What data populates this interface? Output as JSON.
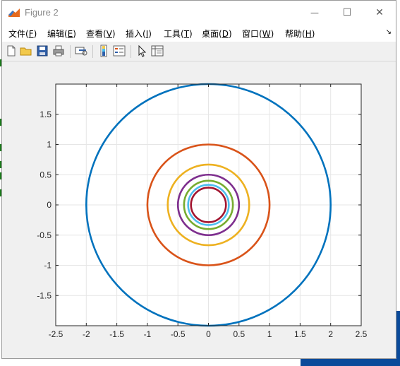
{
  "window": {
    "title": "Figure 2",
    "minimize_glyph": "—",
    "maximize_glyph": "☐",
    "close_glyph": "✕"
  },
  "menu": {
    "items": [
      {
        "label": "文件(",
        "key": "F",
        "suffix": ")"
      },
      {
        "label": "编辑(",
        "key": "E",
        "suffix": ")"
      },
      {
        "label": "查看(",
        "key": "V",
        "suffix": ")"
      },
      {
        "label": "插入(",
        "key": "I",
        "suffix": ")"
      },
      {
        "label": "工具(",
        "key": "T",
        "suffix": ")"
      },
      {
        "label": "桌面(",
        "key": "D",
        "suffix": ")"
      },
      {
        "label": "窗口(",
        "key": "W",
        "suffix": ")"
      },
      {
        "label": "帮助(",
        "key": "H",
        "suffix": ")"
      }
    ],
    "overflow_glyph": "↘"
  },
  "toolbar": {
    "icons": [
      "new-figure-icon",
      "open-file-icon",
      "save-icon",
      "print-icon",
      "link-plot-icon",
      "insert-colorbar-icon",
      "insert-legend-icon",
      "edit-plot-arrow-icon",
      "property-inspector-icon"
    ]
  },
  "chart_data": {
    "type": "line",
    "title": "",
    "xlabel": "",
    "ylabel": "",
    "xlim": [
      -2.5,
      2.5
    ],
    "ylim": [
      -2,
      2
    ],
    "xticks": [
      "-2.5",
      "-2",
      "-1.5",
      "-1",
      "-0.5",
      "0",
      "0.5",
      "1",
      "1.5",
      "2",
      "2.5"
    ],
    "yticks": [
      "1.5",
      "1",
      "0.5",
      "0",
      "-0.5",
      "-1",
      "-1.5"
    ],
    "grid": true,
    "series": [
      {
        "shape": "circle",
        "radius": 2.0,
        "color": "#0072bd"
      },
      {
        "shape": "circle",
        "radius": 1.0,
        "color": "#d95319"
      },
      {
        "shape": "circle",
        "radius": 0.667,
        "color": "#edb120"
      },
      {
        "shape": "circle",
        "radius": 0.5,
        "color": "#7e2f8e"
      },
      {
        "shape": "circle",
        "radius": 0.4,
        "color": "#77ac30"
      },
      {
        "shape": "circle",
        "radius": 0.333,
        "color": "#4dbeee"
      },
      {
        "shape": "circle",
        "radius": 0.286,
        "color": "#a2142f"
      }
    ]
  }
}
